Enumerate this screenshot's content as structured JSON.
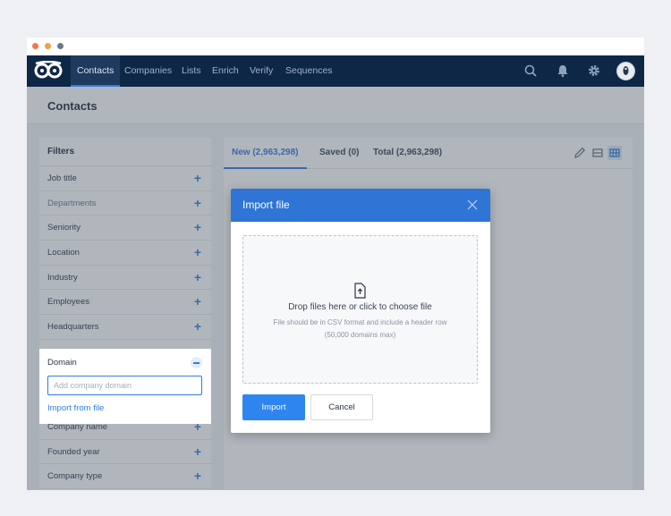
{
  "nav": {
    "logo_icon": "owl-logo-icon",
    "items": [
      {
        "label": "Contacts"
      },
      {
        "label": "Companies"
      },
      {
        "label": "Lists"
      },
      {
        "label": "Enrich"
      },
      {
        "label": "Verify"
      },
      {
        "label": "Sequences"
      }
    ],
    "icons": [
      "search-icon",
      "bell-icon",
      "gear-icon",
      "avatar"
    ]
  },
  "page": {
    "title": "Contacts"
  },
  "filters": {
    "title": "Filters",
    "items": [
      {
        "label": "Job title"
      },
      {
        "label": "Departments"
      },
      {
        "label": "Seniority"
      },
      {
        "label": "Location"
      },
      {
        "label": "Industry"
      },
      {
        "label": "Employees"
      },
      {
        "label": "Headquarters"
      }
    ],
    "domain": {
      "label": "Domain",
      "placeholder": "Add company domain",
      "import_link": "Import from file"
    },
    "items_after": [
      {
        "label": "Company name"
      },
      {
        "label": "Founded year"
      },
      {
        "label": "Company type"
      }
    ]
  },
  "results": {
    "tabs": [
      {
        "label": "New (2,963,298)"
      },
      {
        "label": "Saved (0)"
      },
      {
        "label": "Total (2,963,298)"
      }
    ],
    "view_icons": [
      "pencil-icon",
      "list-view-icon",
      "grid-view-icon"
    ]
  },
  "modal": {
    "title": "Import file",
    "drop_text": "Drop files here or click to choose file",
    "hint_line1": "File should be in CSV format and include a header row",
    "hint_line2": "(50,000 domains max)",
    "import_button": "Import",
    "cancel_button": "Cancel"
  },
  "colors": {
    "nav_bg": "#0f2747",
    "accent": "#2e75d6",
    "primary_button": "#2e85f0"
  }
}
